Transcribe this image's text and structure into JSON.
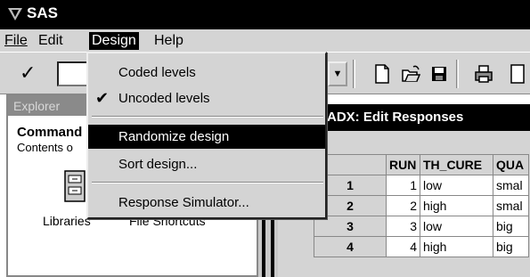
{
  "window": {
    "title": "SAS"
  },
  "menubar": {
    "file": "File",
    "edit": "Edit",
    "design": "Design",
    "help": "Help"
  },
  "design_menu": {
    "items": [
      {
        "label": "Coded levels",
        "checked": false
      },
      {
        "label": "Uncoded levels",
        "checked": true
      },
      {
        "label": "Randomize design",
        "highlighted": true
      },
      {
        "label": "Sort design..."
      },
      {
        "label": "Response Simulator..."
      }
    ]
  },
  "explorer": {
    "title": "Explorer",
    "heading": "Command",
    "subtitle": "Contents o",
    "libraries_label": "Libraries",
    "shortcuts_label": "File Shortcuts"
  },
  "adx_window": {
    "title": "ADX: Edit Responses",
    "columns": [
      "",
      "RUN",
      "TH_CURE",
      "QUA"
    ],
    "rows": [
      {
        "row": "1",
        "run": "1",
        "th_cure": "low",
        "qua": "smal"
      },
      {
        "row": "2",
        "run": "2",
        "th_cure": "high",
        "qua": "smal"
      },
      {
        "row": "3",
        "run": "3",
        "th_cure": "low",
        "qua": "big"
      },
      {
        "row": "4",
        "run": "4",
        "th_cure": "high",
        "qua": "big"
      }
    ]
  },
  "icons": [
    "sas-logo-icon",
    "checkmark-icon",
    "new-document-icon",
    "open-folder-icon",
    "save-icon",
    "print-icon",
    "combo-dropdown-icon",
    "library-cabinet-icon"
  ]
}
